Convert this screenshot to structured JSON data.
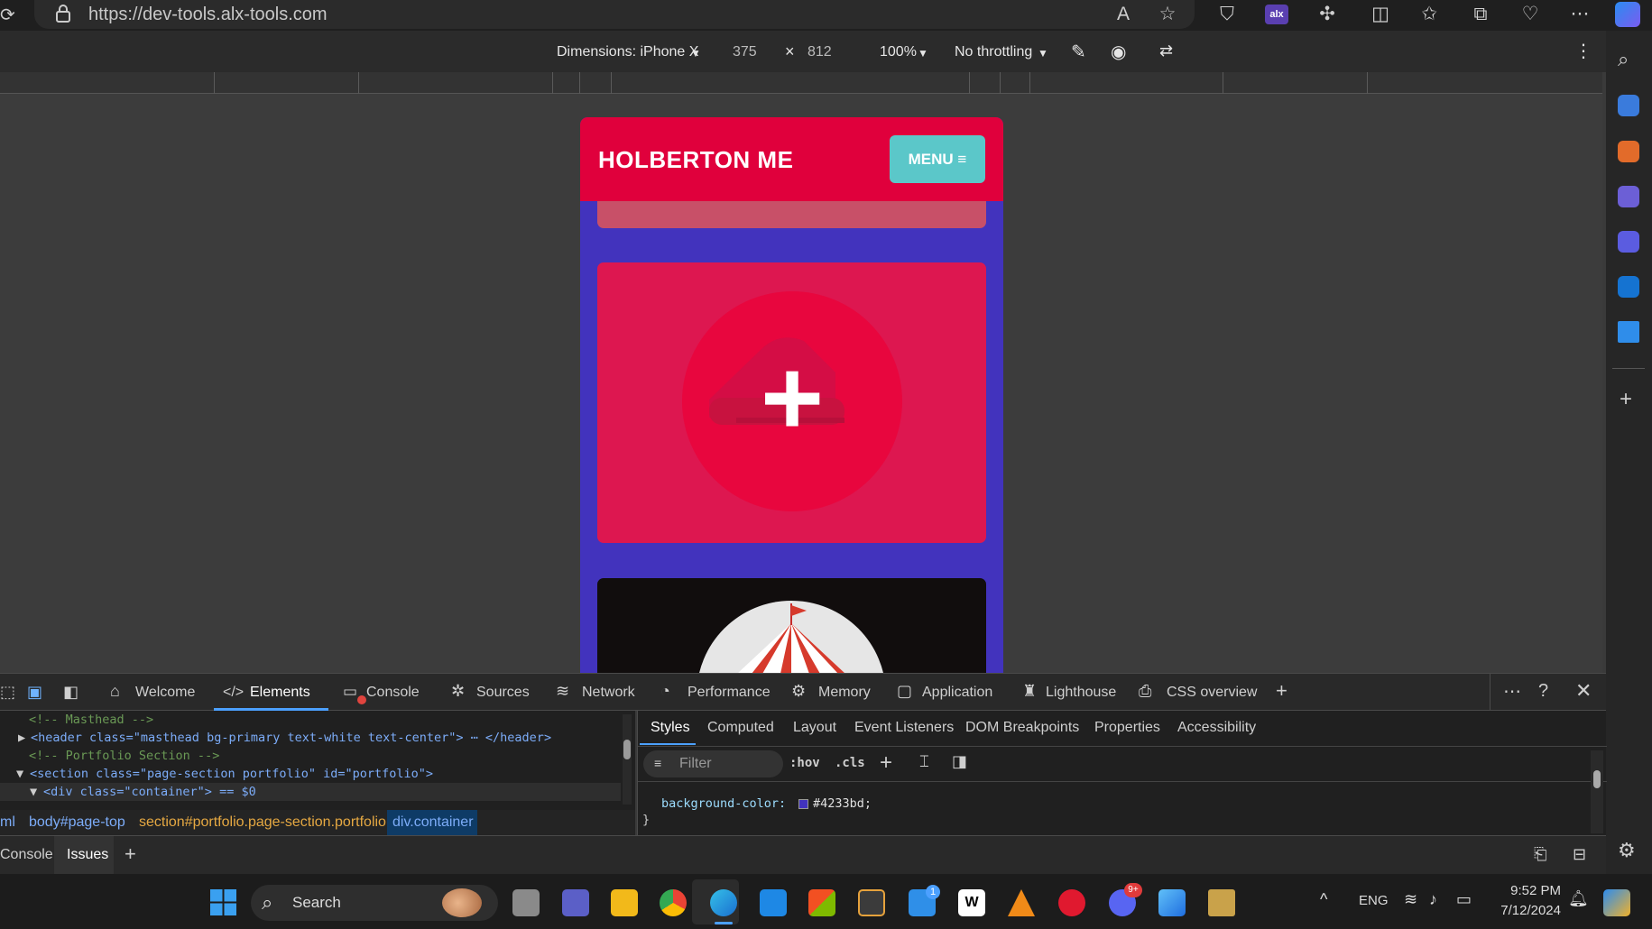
{
  "browser": {
    "url": "https://dev-tools.alx-tools.com",
    "alx_badge": "alx"
  },
  "device_toolbar": {
    "dimensions_label": "Dimensions: iPhone X",
    "width": "375",
    "times": "×",
    "height": "812",
    "zoom": "100%",
    "throttling": "No throttling"
  },
  "page": {
    "brand": "HOLBERTON ME",
    "menu_label": "MENU ≡",
    "plus": "+"
  },
  "devtools": {
    "tabs": [
      "Welcome",
      "Elements",
      "Console",
      "Sources",
      "Network",
      "Performance",
      "Memory",
      "Application",
      "Lighthouse",
      "CSS overview"
    ],
    "dom_lines": [
      {
        "text": "<!-- Masthead -->",
        "indent": 1
      },
      {
        "text": "<header class=\"masthead bg-primary text-white text-center\"> ⋯ </header>",
        "indent": 1
      },
      {
        "text": "<!-- Portfolio Section -->",
        "indent": 1
      },
      {
        "text": "<section class=\"page-section portfolio\" id=\"portfolio\">",
        "indent": 1
      },
      {
        "text": "<div class=\"container\"> == $0",
        "indent": 2
      }
    ],
    "breadcrumbs": [
      "ml",
      "body#page-top",
      "section#portfolio.page-section.portfolio",
      "div.container"
    ],
    "style_tabs": [
      "Styles",
      "Computed",
      "Layout",
      "Event Listeners",
      "DOM Breakpoints",
      "Properties",
      "Accessibility"
    ],
    "filter_placeholder": "Filter",
    "hov": ":hov",
    "cls": ".cls",
    "css_prop": "background-color:",
    "css_value": "#4233bd;",
    "css_close": "}",
    "drawer_tabs": [
      "Console",
      "Issues"
    ]
  },
  "taskbar": {
    "search": "Search",
    "lang": "ENG",
    "time": "9:52 PM",
    "date": "7/12/2024",
    "mail_badge": "1",
    "discord_badge": "9+"
  },
  "colors": {
    "brand_red": "#e0003c",
    "section_blue": "#4233bd",
    "menu_teal": "#5bc7c9"
  }
}
